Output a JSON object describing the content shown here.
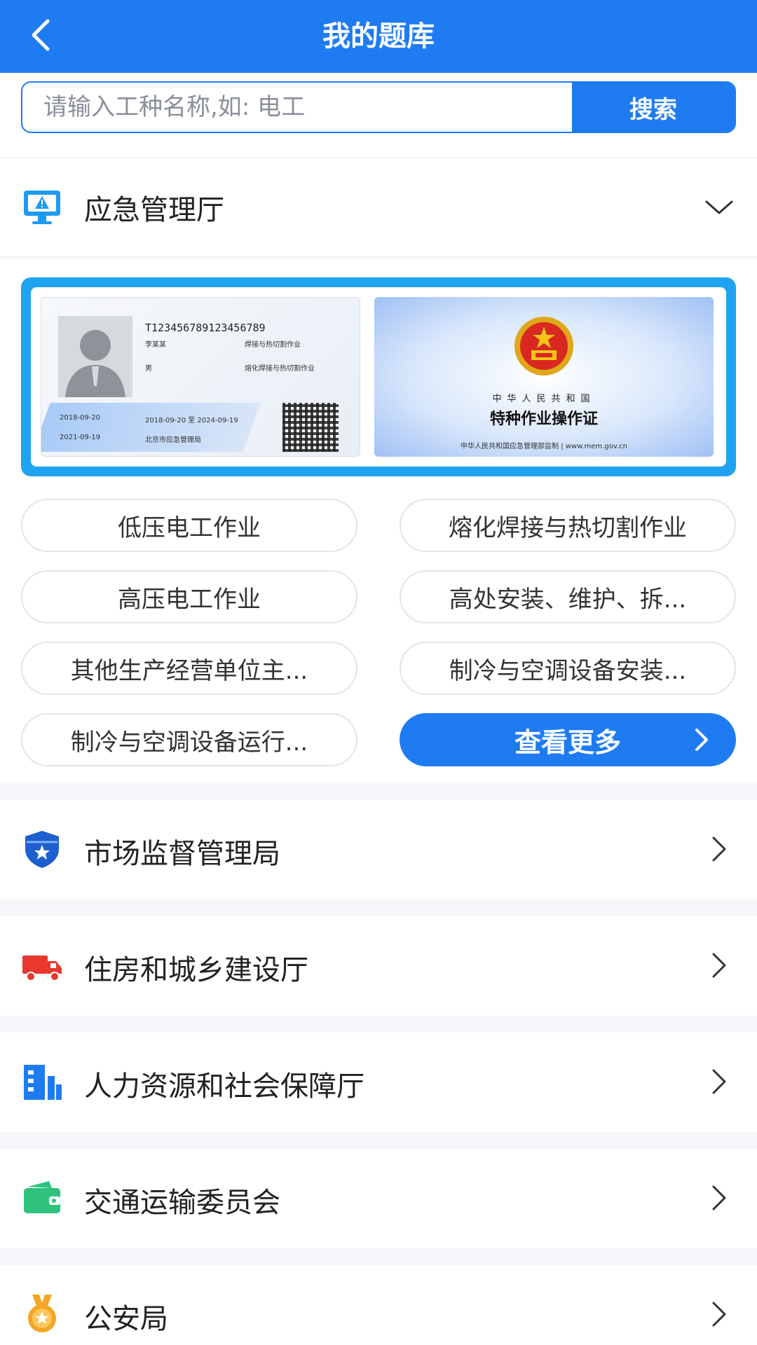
{
  "header": {
    "title": "我的题库"
  },
  "search": {
    "placeholder": "请输入工种名称,如: 电工",
    "button_label": "搜索"
  },
  "expanded_section": {
    "label": "应急管理厅",
    "card_front": {
      "number": "T123456789123456789",
      "name": "李某某",
      "job_class": "焊接与热切割作业",
      "gender": "男",
      "project": "熔化焊接与热切割作业",
      "first_date": "2018-09-20",
      "valid_period": "2018-09-20 至 2024-09-19",
      "review_date": "2021-09-19",
      "issuer": "北京市应急管理局"
    },
    "card_back": {
      "country": "中华人民共和国",
      "title": "特种作业操作证",
      "footer": "中华人民共和国应急管理部监制 | www.mem.gov.cn"
    },
    "chips": [
      "低压电工作业",
      "熔化焊接与热切割作业",
      "高压电工作业",
      "高处安装、维护、拆...",
      "其他生产经营单位主...",
      "制冷与空调设备安装...",
      "制冷与空调设备运行..."
    ],
    "more_label": "查看更多"
  },
  "sections": [
    {
      "label": "市场监督管理局",
      "icon": "shield-star-icon",
      "color": "#1e5fd0"
    },
    {
      "label": "住房和城乡建设厅",
      "icon": "truck-icon",
      "color": "#e8382f"
    },
    {
      "label": "人力资源和社会保障厅",
      "icon": "building-icon",
      "color": "#1e7bf2"
    },
    {
      "label": "交通运输委员会",
      "icon": "wallet-icon",
      "color": "#2ec27e"
    },
    {
      "label": "公安局",
      "icon": "medal-icon",
      "color": "#f3a623"
    }
  ]
}
